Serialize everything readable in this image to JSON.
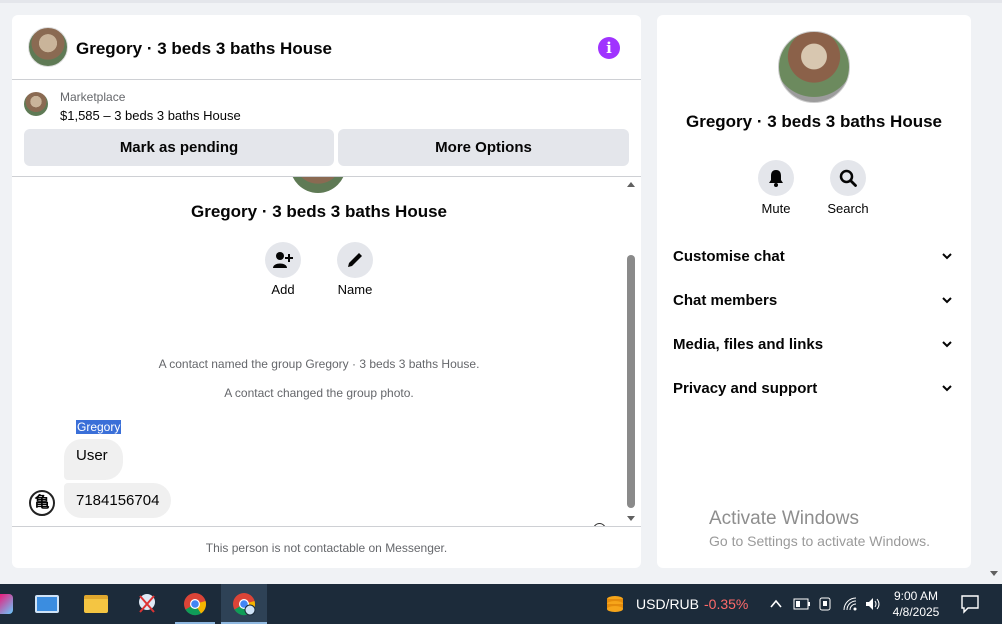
{
  "chat": {
    "header_title": "Gregory · 3 beds 3 baths House",
    "marketplace_label": "Marketplace",
    "listing_price_title": "$1,585 – 3 beds 3 baths House",
    "mark_pending_label": "Mark as pending",
    "more_options_label": "More Options",
    "group_name": "Gregory · 3 beds 3 baths House",
    "actions": [
      {
        "label": "Add",
        "icon": "add-person-icon"
      },
      {
        "label": "Name",
        "icon": "pencil-icon"
      }
    ],
    "system_messages": [
      "A contact named the group Gregory · 3 beds 3 baths House.",
      "A contact changed the group photo."
    ],
    "sender_name": "Gregory",
    "messages": [
      "User",
      "7184156704"
    ],
    "footer_note": "This person is not contactable on Messenger."
  },
  "info_panel": {
    "title": "Gregory · 3 beds 3 baths House",
    "buttons": [
      {
        "label": "Mute",
        "icon": "bell-icon"
      },
      {
        "label": "Search",
        "icon": "search-icon"
      }
    ],
    "sections": [
      "Customise chat",
      "Chat members",
      "Media, files and links",
      "Privacy and support"
    ],
    "watermark_title": "Activate Windows",
    "watermark_sub": "Go to Settings to activate Windows."
  },
  "taskbar": {
    "currency_pair": "USD/RUB",
    "currency_change": "-0.35%",
    "time": "9:00 AM",
    "date": "4/8/2025"
  },
  "colors": {
    "accent": "#a033ff",
    "bubble": "#f0f0f0",
    "button": "#e4e6eb",
    "taskbar": "#1c2b3a",
    "negative": "#ff6a6a"
  }
}
